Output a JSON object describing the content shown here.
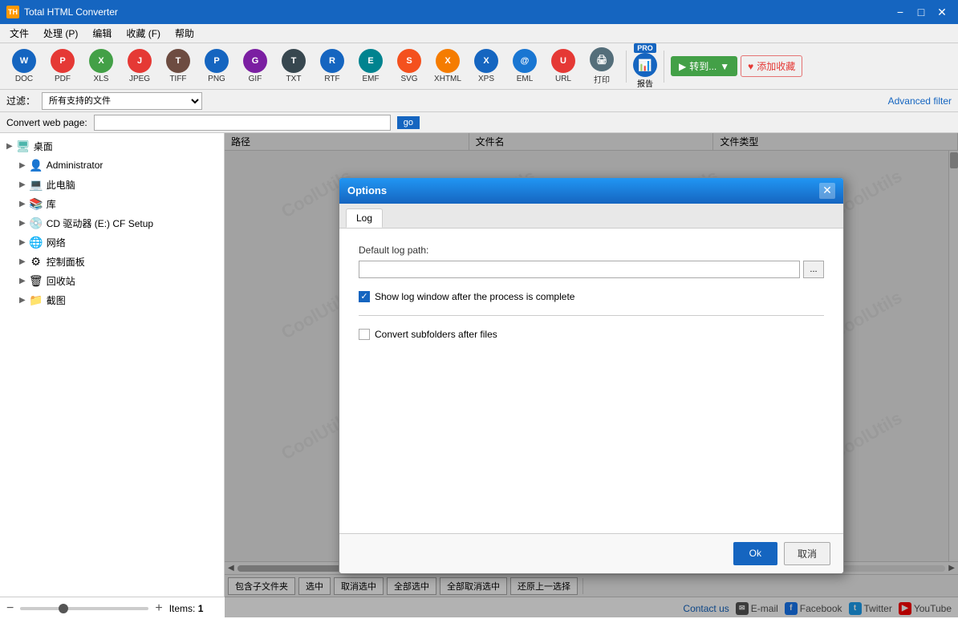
{
  "app": {
    "title": "Total HTML Converter",
    "title_icon": "TH"
  },
  "title_bar": {
    "minimize": "−",
    "maximize": "□",
    "close": "✕"
  },
  "menu": {
    "items": [
      "文件",
      "处理 (P)",
      "编辑",
      "收藏 (F)",
      "帮助"
    ]
  },
  "toolbar": {
    "tools": [
      {
        "id": "doc",
        "label": "DOC",
        "color": "doc"
      },
      {
        "id": "pdf",
        "label": "PDF",
        "color": "pdf"
      },
      {
        "id": "xls",
        "label": "XLS",
        "color": "xls"
      },
      {
        "id": "jpeg",
        "label": "JPEG",
        "color": "jpeg"
      },
      {
        "id": "tiff",
        "label": "TIFF",
        "color": "tiff"
      },
      {
        "id": "png",
        "label": "PNG",
        "color": "png"
      },
      {
        "id": "gif",
        "label": "GIF",
        "color": "gif"
      },
      {
        "id": "txt",
        "label": "TXT",
        "color": "txt"
      },
      {
        "id": "rtf",
        "label": "RTF",
        "color": "rtf"
      },
      {
        "id": "emf",
        "label": "EMF",
        "color": "emf"
      },
      {
        "id": "svg",
        "label": "SVG",
        "color": "svg-icon"
      },
      {
        "id": "xhtml",
        "label": "XHTML",
        "color": "xhtml"
      },
      {
        "id": "xps",
        "label": "XPS",
        "color": "xps"
      },
      {
        "id": "eml",
        "label": "EML",
        "color": "eml"
      },
      {
        "id": "url",
        "label": "URL",
        "color": "url"
      },
      {
        "id": "print",
        "label": "打印",
        "color": "print"
      }
    ],
    "convert_label": "转到...",
    "favorite_label": "添加收藏",
    "filter_label": "过滤：",
    "filter_value": "所有支持的文件",
    "advanced_filter": "Advanced filter",
    "report_label": "报告",
    "pro_label": "PRO"
  },
  "webpage": {
    "label": "Convert web page:",
    "placeholder": "",
    "go_label": "go"
  },
  "columns": {
    "headers": [
      "路径",
      "文件名",
      "文件类型"
    ]
  },
  "sidebar": {
    "items": [
      {
        "label": "桌面",
        "icon": "desktop",
        "level": 0
      },
      {
        "label": "Administrator",
        "icon": "user",
        "level": 1
      },
      {
        "label": "此电脑",
        "icon": "computer",
        "level": 1
      },
      {
        "label": "库",
        "icon": "library",
        "level": 1
      },
      {
        "label": "CD 驱动器 (E:) CF Setup",
        "icon": "cd",
        "level": 1
      },
      {
        "label": "网络",
        "icon": "network",
        "level": 1
      },
      {
        "label": "控制面板",
        "icon": "control",
        "level": 1
      },
      {
        "label": "回收站",
        "icon": "trash",
        "level": 1
      },
      {
        "label": "截图",
        "icon": "screenshot",
        "level": 1
      }
    ]
  },
  "dialog": {
    "title": "Options",
    "close_label": "✕",
    "tabs": [
      "Log"
    ],
    "log_path_label": "Default log path:",
    "log_path_value": "",
    "browse_label": "...",
    "show_log_label": "Show log window after the process is complete",
    "show_log_checked": true,
    "convert_subfolders_label": "Convert subfolders after files",
    "convert_subfolders_checked": false,
    "ok_label": "Ok",
    "cancel_label": "取消"
  },
  "bottom_toolbar": {
    "buttons": [
      "包含子文件夹",
      "选中",
      "取消选中",
      "全部选中",
      "全部取消选中",
      "还原上一选择"
    ]
  },
  "footer": {
    "items_label": "Items:",
    "items_count": "1",
    "contact_label": "Contact us",
    "email_label": "E-mail",
    "facebook_label": "Facebook",
    "twitter_label": "Twitter",
    "youtube_label": "YouTube"
  },
  "watermark_text": "CoolUtils"
}
